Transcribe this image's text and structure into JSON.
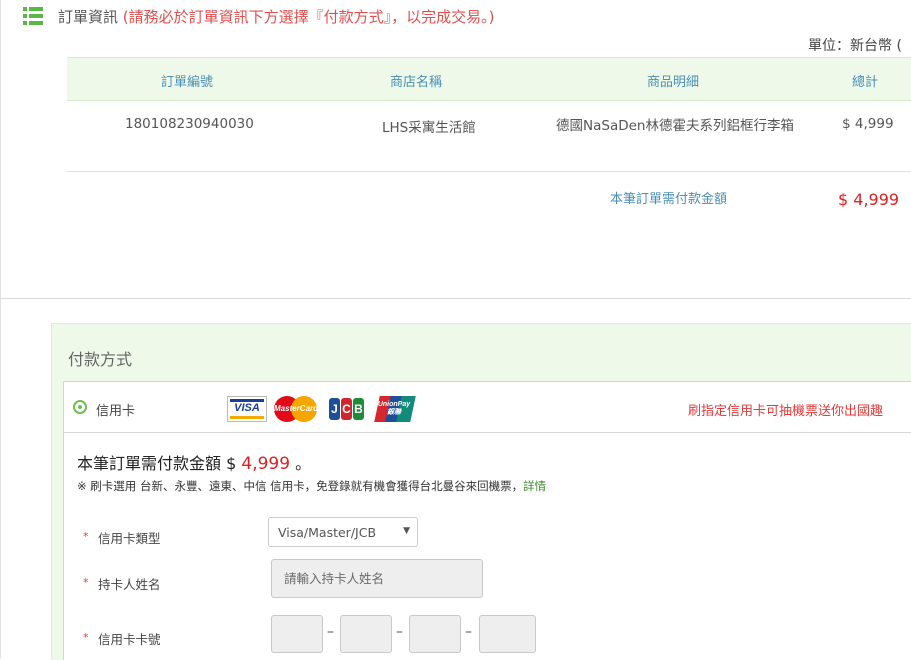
{
  "header": {
    "title": "訂單資訊",
    "note": "(請務必於訂單資訊下方選擇『付款方式』，以完成交易。)",
    "unit": "單位：新台幣 ("
  },
  "order_table": {
    "columns": [
      "訂單編號",
      "商店名稱",
      "商品明細",
      "總計"
    ],
    "row": {
      "order_no": "180108230940030",
      "store": "LHS采寓生活館",
      "item": "德國NaSaDen林德霍夫系列鋁框行李箱",
      "total": "$ 4,999"
    },
    "summary_label": "本筆訂單需付款金額",
    "summary_amount": "$ 4,999"
  },
  "payment": {
    "title": "付款方式",
    "method_label": "信用卡",
    "logos": {
      "visa": "VISA",
      "mastercard": "MasterCard",
      "jcb": [
        "J",
        "C",
        "B"
      ],
      "unionpay": "UnionPay 銀聯"
    },
    "promo": "刷指定信用卡可抽機票送你出國趣",
    "amount_prefix": "本筆訂單需付款金額 $",
    "amount": "4,999",
    "amount_suffix": "。",
    "bank_note": "※ 刷卡選用 台新、永豐、遠東、中信 信用卡，免登錄就有機會獲得台北曼谷來回機票，",
    "details_link": "詳情",
    "required_mark": "*",
    "fields": {
      "card_type_label": "信用卡類型",
      "card_type_value": "Visa/Master/JCB",
      "holder_label": "持卡人姓名",
      "holder_placeholder": "請輸入持卡人姓名",
      "card_number_label": "信用卡卡號",
      "separator": "–"
    }
  },
  "colors": {
    "accent_green": "#58b747",
    "table_header_bg": "#eef9e9",
    "header_text_blue": "#4a8fb7",
    "alert_red": "#e02020"
  }
}
